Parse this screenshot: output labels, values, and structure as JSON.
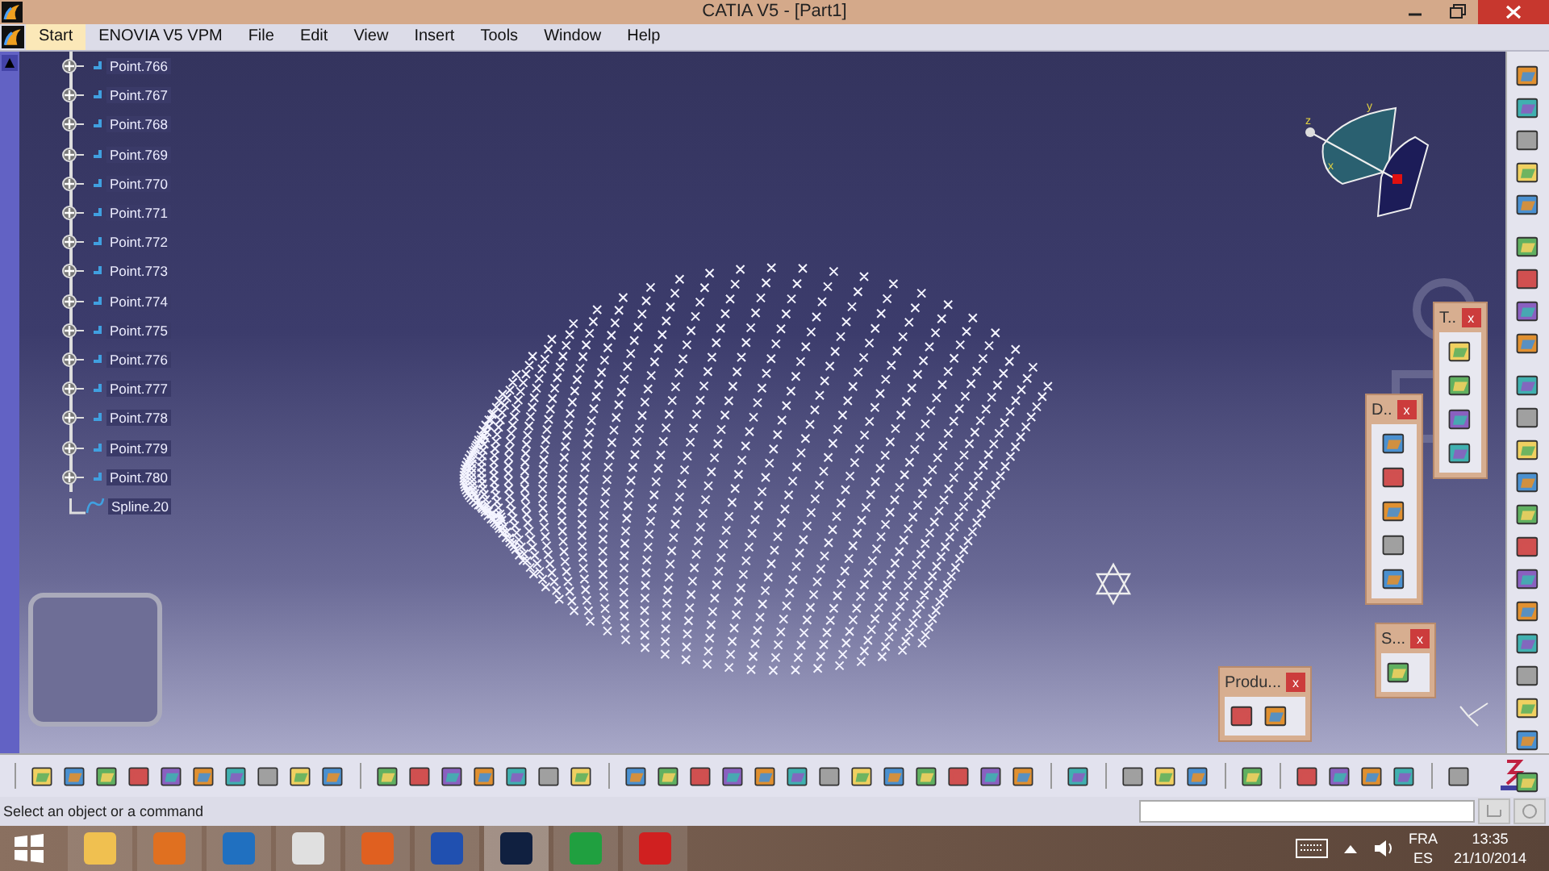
{
  "window": {
    "title": "CATIA V5 - [Part1]"
  },
  "menu": [
    {
      "label": "Start",
      "selected": true
    },
    {
      "label": "ENOVIA V5 VPM",
      "selected": false
    },
    {
      "label": "File",
      "selected": false
    },
    {
      "label": "Edit",
      "selected": false
    },
    {
      "label": "View",
      "selected": false
    },
    {
      "label": "Insert",
      "selected": false
    },
    {
      "label": "Tools",
      "selected": false
    },
    {
      "label": "Window",
      "selected": false
    },
    {
      "label": "Help",
      "selected": false
    }
  ],
  "tree": {
    "items": [
      {
        "label": "Point.766",
        "kind": "point"
      },
      {
        "label": "Point.767",
        "kind": "point"
      },
      {
        "label": "Point.768",
        "kind": "point"
      },
      {
        "label": "Point.769",
        "kind": "point"
      },
      {
        "label": "Point.770",
        "kind": "point"
      },
      {
        "label": "Point.771",
        "kind": "point"
      },
      {
        "label": "Point.772",
        "kind": "point"
      },
      {
        "label": "Point.773",
        "kind": "point"
      },
      {
        "label": "Point.774",
        "kind": "point"
      },
      {
        "label": "Point.775",
        "kind": "point"
      },
      {
        "label": "Point.776",
        "kind": "point"
      },
      {
        "label": "Point.777",
        "kind": "point"
      },
      {
        "label": "Point.778",
        "kind": "point"
      },
      {
        "label": "Point.779",
        "kind": "point"
      },
      {
        "label": "Point.780",
        "kind": "point"
      },
      {
        "label": "Spline.20",
        "kind": "spline"
      }
    ]
  },
  "compass": {
    "axes": [
      "z",
      "y",
      "x"
    ]
  },
  "floating_toolbars": [
    {
      "title": "T..",
      "close": "x"
    },
    {
      "title": "D..",
      "close": "x"
    },
    {
      "title": "S...",
      "close": "x"
    },
    {
      "title": "Produ...",
      "close": "x"
    }
  ],
  "status_bar": {
    "message": "Select an object or a command"
  },
  "taskbar": {
    "language": "FRA",
    "layout": "ES",
    "time": "13:35",
    "date": "21/10/2014"
  }
}
